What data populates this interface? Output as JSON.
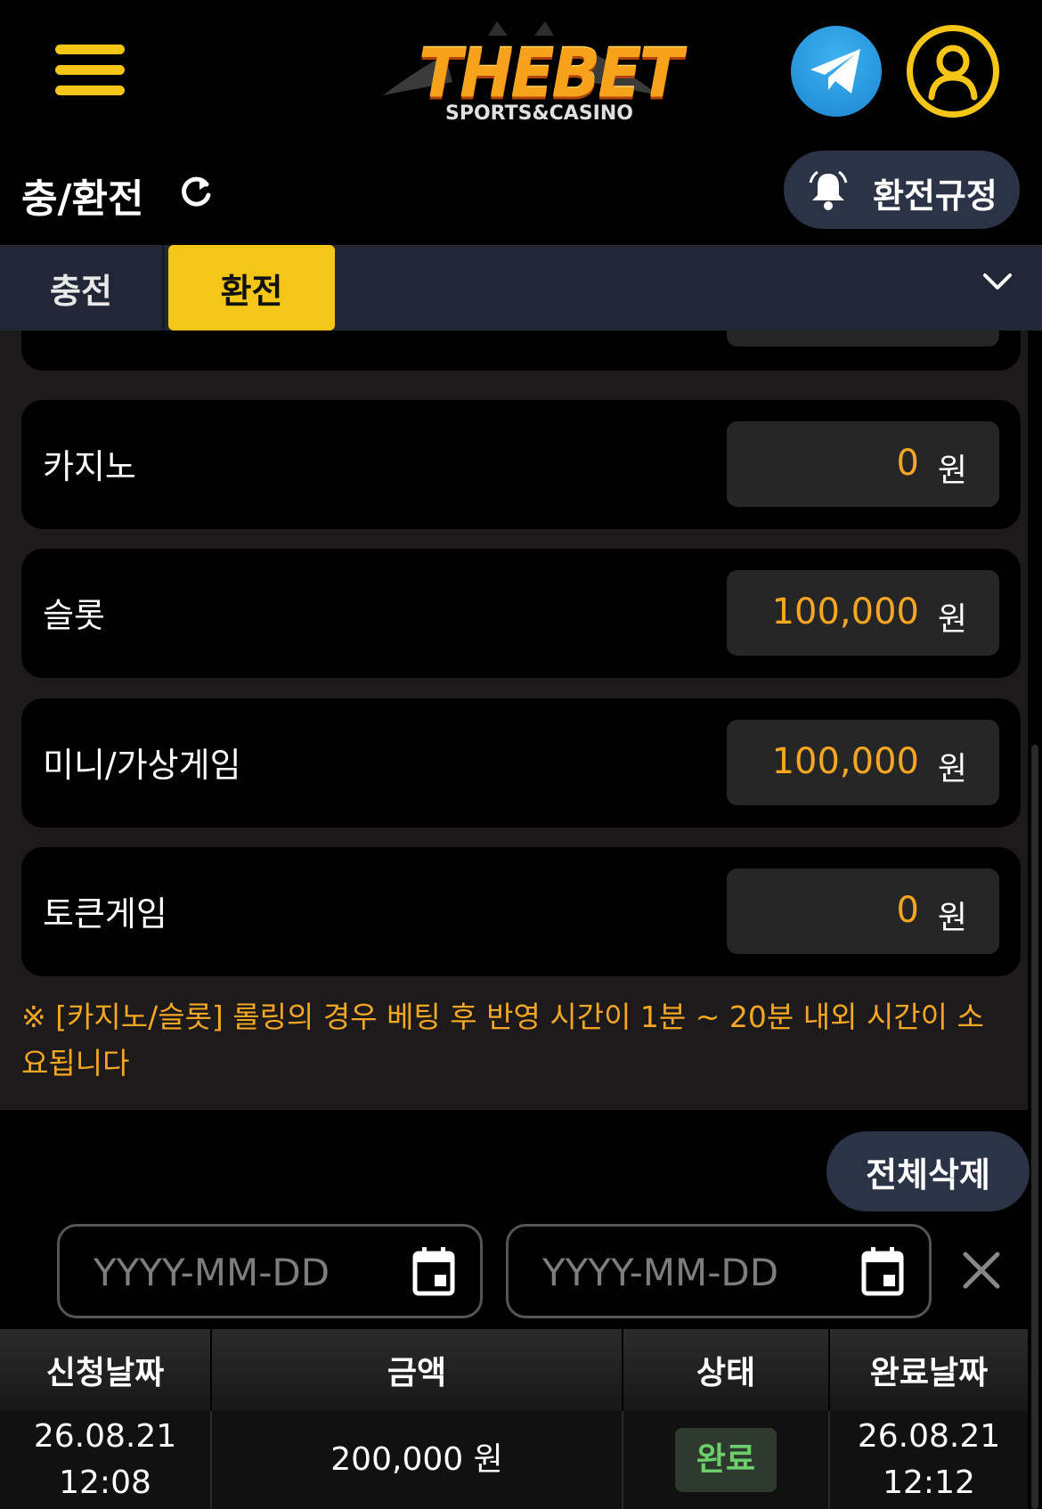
{
  "header": {
    "logo_main": "THEBET",
    "logo_sub": "SPORTS&CASINO",
    "menu_icon": "hamburger-menu-icon",
    "telegram_icon": "telegram-icon",
    "user_icon": "user-icon"
  },
  "title_row": {
    "title": "충/환전",
    "rule_button": "환전규정"
  },
  "tabs": [
    {
      "label": "충전",
      "active": false
    },
    {
      "label": "환전",
      "active": true
    }
  ],
  "games": [
    {
      "label": "카지노",
      "value": "0",
      "unit": "원"
    },
    {
      "label": "슬롯",
      "value": "100,000",
      "unit": "원"
    },
    {
      "label": "미니/가상게임",
      "value": "100,000",
      "unit": "원"
    },
    {
      "label": "토큰게임",
      "value": "0",
      "unit": "원"
    }
  ],
  "notice": "※ [카지노/슬롯] 롤링의 경우 베팅 후 반영 시간이 1분 ~ 20분 내외 시간이 소요됩니다",
  "history": {
    "delete_all": "전체삭제",
    "date_placeholder_from": "YYYY-MM-DD",
    "date_placeholder_to": "YYYY-MM-DD",
    "columns": [
      "신청날짜",
      "금액",
      "상태",
      "완료날짜"
    ],
    "rows": [
      {
        "request_date": "26.08.21",
        "request_time": "12:08",
        "amount": "200,000 원",
        "status": "완료",
        "complete_date": "26.08.21",
        "complete_time": "12:12"
      }
    ]
  },
  "colors": {
    "accent": "#f5c518",
    "amount": "#f5a623",
    "status_done": "#6ccf6c"
  }
}
